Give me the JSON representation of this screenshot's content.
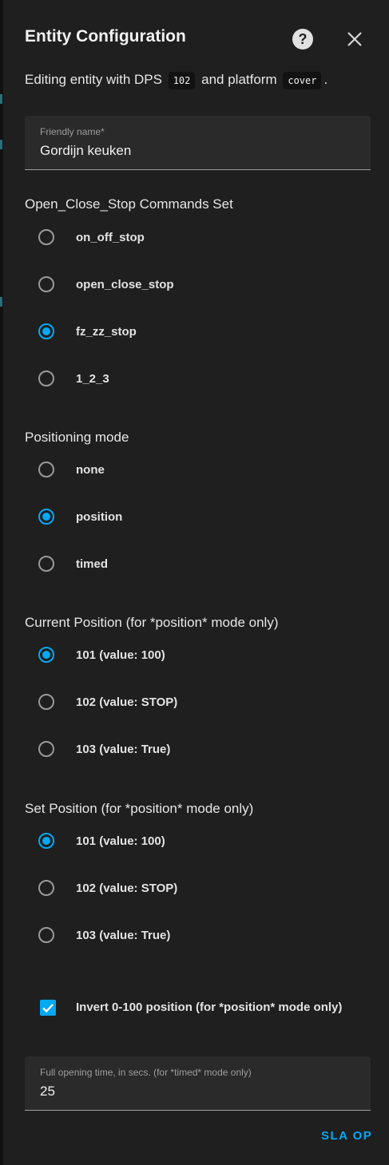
{
  "dialog": {
    "title": "Entity Configuration",
    "description": {
      "prefix": "Editing entity with DPS",
      "dps": "102",
      "middle": "and platform",
      "platform": "cover",
      "suffix": "."
    }
  },
  "friendly_name": {
    "label": "Friendly name*",
    "value": "Gordijn keuken"
  },
  "commands_set": {
    "title": "Open_Close_Stop Commands Set",
    "options": [
      "on_off_stop",
      "open_close_stop",
      "fz_zz_stop",
      "1_2_3"
    ],
    "selected": "fz_zz_stop"
  },
  "positioning_mode": {
    "title": "Positioning mode",
    "options": [
      "none",
      "position",
      "timed"
    ],
    "selected": "position"
  },
  "current_position": {
    "title": "Current Position (for *position* mode only)",
    "options": [
      "101 (value: 100)",
      "102 (value: STOP)",
      "103 (value: True)"
    ],
    "selected": "101 (value: 100)"
  },
  "set_position": {
    "title": "Set Position (for *position* mode only)",
    "options": [
      "101 (value: 100)",
      "102 (value: STOP)",
      "103 (value: True)"
    ],
    "selected": "101 (value: 100)"
  },
  "invert": {
    "label": "Invert 0-100 position (for *position* mode only)",
    "checked": true
  },
  "opening_time": {
    "label": "Full opening time, in secs. (for *timed* mode only)",
    "value": "25"
  },
  "actions": {
    "submit_label": "SLA OP"
  },
  "colors": {
    "accent": "#03a9f4",
    "surface": "#1f1f1f",
    "field": "#2a2a2a"
  }
}
